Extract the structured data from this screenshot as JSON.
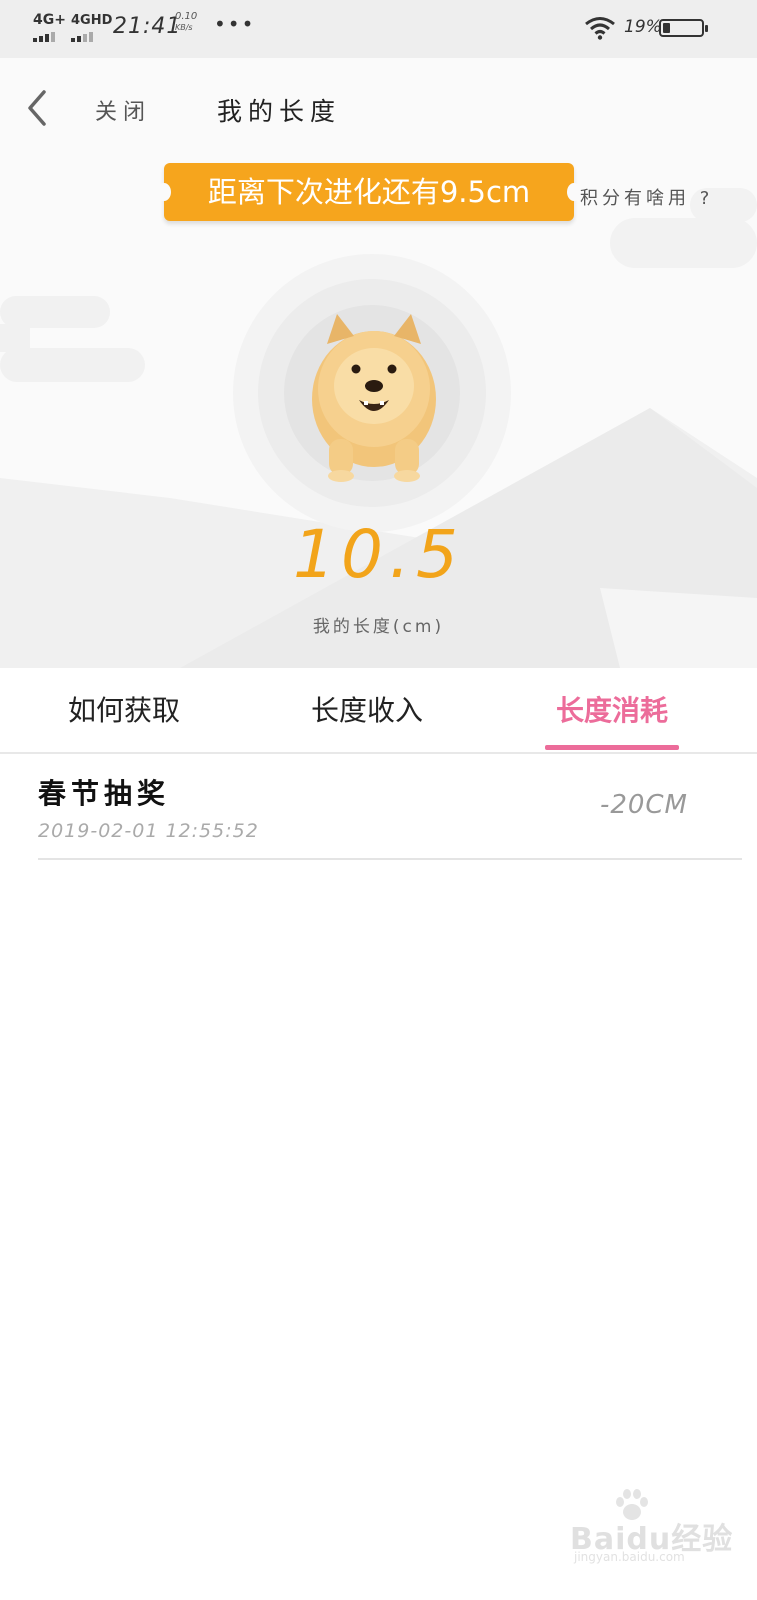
{
  "status_bar": {
    "signal1": "4G+",
    "signal2": "4GHD",
    "time": "21:41",
    "speed_value": "0.10",
    "speed_unit": "KB/s",
    "more": "•••",
    "battery_percent": "19%",
    "battery_level": 0.19
  },
  "nav": {
    "close_label": "关闭",
    "title": "我的长度"
  },
  "hero": {
    "ribbon_text": "距离下次进化还有9.5cm",
    "help_link": "积分有啥用 ?",
    "length_value": "10.5",
    "length_caption": "我的长度(cm)"
  },
  "tabs": [
    {
      "label": "如何获取",
      "active": false
    },
    {
      "label": "长度收入",
      "active": false
    },
    {
      "label": "长度消耗",
      "active": true
    }
  ],
  "records": [
    {
      "title": "春节抽奖",
      "time": "2019-02-01 12:55:52",
      "amount": "-20CM"
    }
  ],
  "watermark": {
    "text": "Baidu经验",
    "sub": "jingyan.baidu.com"
  },
  "colors": {
    "accent_orange": "#f6a51d",
    "accent_pink": "#ec6c9a"
  }
}
